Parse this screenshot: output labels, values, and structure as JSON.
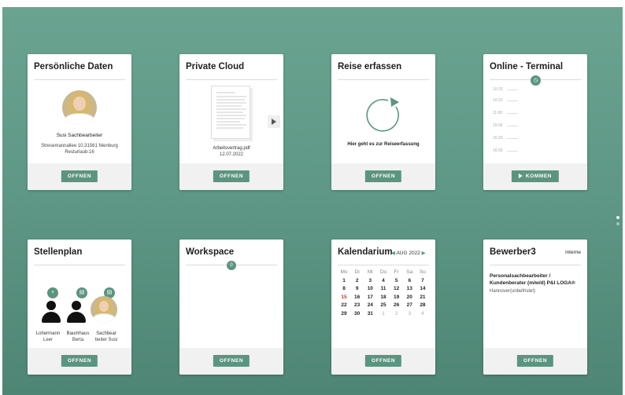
{
  "cards": {
    "personal": {
      "title": "Persönliche Daten",
      "name": "Susi Sachbearbeiter",
      "address": "Stresemannallee 10,31561 Nienburg",
      "leave": "Resturlaub:16",
      "button": "OFFNEN"
    },
    "cloud": {
      "title": "Private Cloud",
      "file_name": "Arbeitsvertrag.pdf",
      "file_date": "12.07.2022",
      "button": "OFFNEN"
    },
    "travel": {
      "title": "Reise erfassen",
      "text": "Hier geht es zur Reiseerfassung",
      "button": "OFFNEN"
    },
    "terminal": {
      "title": "Online - Terminal",
      "times": [
        "10:23",
        "10:23",
        "11:00",
        "15:00",
        "15:23",
        "16:03"
      ],
      "button": "KOMMEN"
    },
    "staff": {
      "title": "Stellenplan",
      "people": [
        {
          "name": "Lohermann",
          "role": "Leer"
        },
        {
          "name": "Baumhaus",
          "role": "Berta"
        },
        {
          "name": "Sachbear",
          "role": "beiter Susi"
        }
      ],
      "button": "OFFNEN"
    },
    "workspace": {
      "title": "Workspace",
      "marker": "0",
      "button": "OFFNEN"
    },
    "calendar": {
      "title": "Kalendarium",
      "month": "AUG 2022",
      "weekdays": [
        "Mo",
        "Di",
        "Mi",
        "Do",
        "Fr",
        "Sa",
        "So"
      ],
      "weeks": [
        [
          "1",
          "2",
          "3",
          "4",
          "5",
          "6",
          "7"
        ],
        [
          "8",
          "9",
          "10",
          "11",
          "12",
          "13",
          "14"
        ],
        [
          "15",
          "16",
          "17",
          "18",
          "19",
          "20",
          "21"
        ],
        [
          "22",
          "23",
          "24",
          "25",
          "26",
          "27",
          "28"
        ],
        [
          "29",
          "30",
          "31",
          "1",
          "2",
          "3",
          "4"
        ]
      ],
      "button": "OFFNEN"
    },
    "applicant": {
      "title": "Bewerber3",
      "tag": "interne",
      "job_title": "Personalsachbearbeiter / Kundenberater (m/w/d) P&I LOGA®",
      "location": "Hannover(unbefristet)",
      "button": "OFFNEN"
    }
  },
  "colors": {
    "accent": "#5b9580",
    "background_top": "#6aa491",
    "background_bottom": "#4e8574"
  }
}
